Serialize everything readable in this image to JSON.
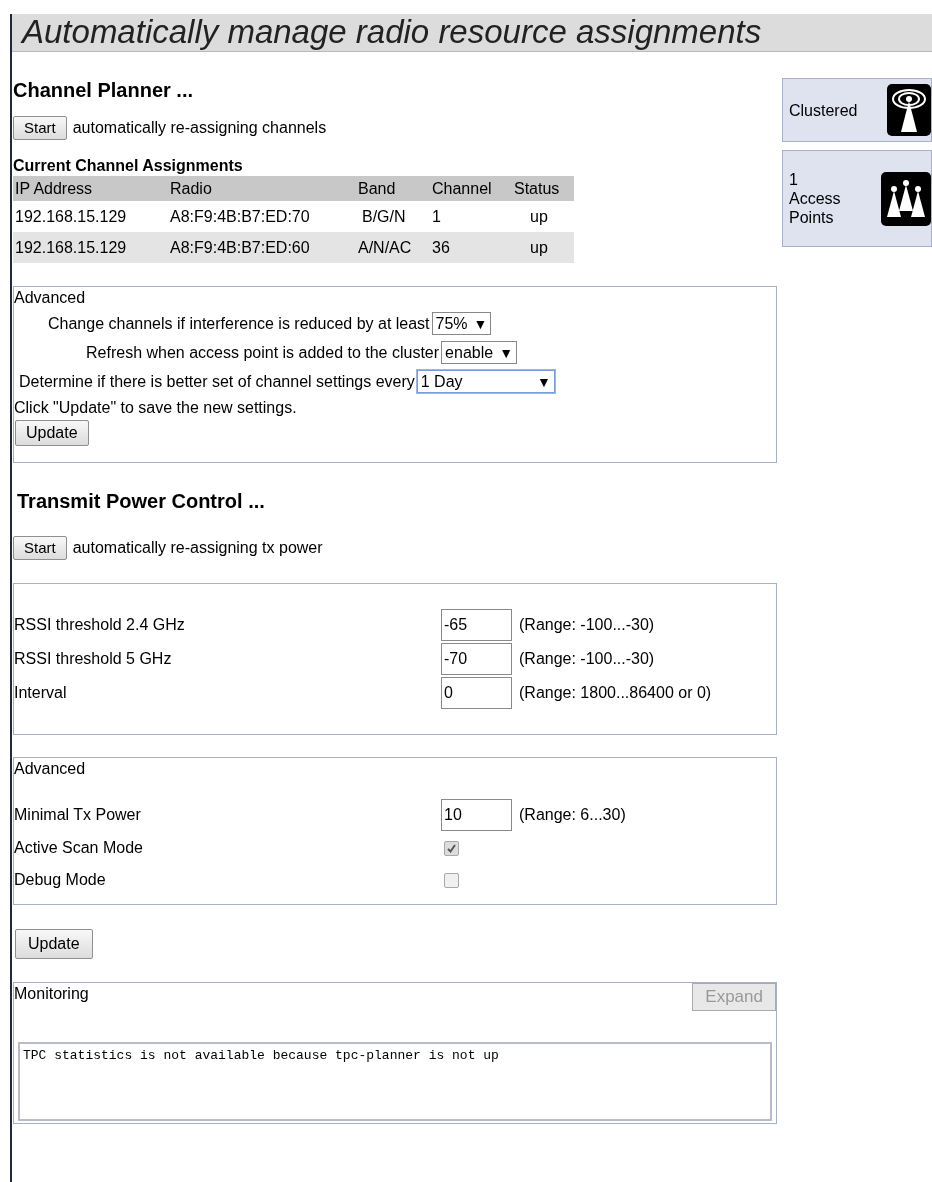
{
  "title": "Automatically manage radio resource assignments",
  "channel_planner": {
    "heading": "Channel Planner ...",
    "start_button": "Start",
    "start_note": "automatically re-assigning channels",
    "assignments_heading": "Current Channel Assignments",
    "table": {
      "columns": [
        "IP Address",
        "Radio",
        "Band",
        "Channel",
        "Status"
      ],
      "rows": [
        [
          "192.168.15.129",
          "A8:F9:4B:B7:ED:70",
          "B/G/N",
          "1",
          "up"
        ],
        [
          "192.168.15.129",
          "A8:F9:4B:B7:ED:60",
          "A/N/AC",
          "36",
          "up"
        ]
      ]
    },
    "advanced": {
      "legend": "Advanced",
      "settings": [
        {
          "label": "Change channels if interference is reduced by at least",
          "value": "75%",
          "arrow": "▼",
          "focused": false
        },
        {
          "label": "Refresh when access point is added to the cluster",
          "value": "enable",
          "arrow": "▼",
          "focused": false
        },
        {
          "label": "Determine if there is better set of channel settings every",
          "value": "1 Day",
          "arrow": "▼",
          "focused": true
        }
      ],
      "note": "Click \"Update\" to save the new settings.",
      "update_button": "Update"
    }
  },
  "status_panels": [
    {
      "kind": "clustered",
      "lines": [
        "Clustered"
      ]
    },
    {
      "kind": "access-points",
      "lines": [
        "1",
        "Access",
        "Points"
      ]
    }
  ],
  "tpc": {
    "heading": "Transmit Power Control ...",
    "start_button": "Start",
    "start_note": "automatically re-assigning tx power",
    "thresholds": [
      {
        "label": "RSSI threshold 2.4 GHz",
        "value": "-65",
        "range": "(Range: -100...-30)"
      },
      {
        "label": "RSSI threshold 5 GHz",
        "value": "-70",
        "range": "(Range: -100...-30)"
      },
      {
        "label": "Interval",
        "value": "0",
        "range": "(Range: 1800...86400 or 0)"
      }
    ],
    "advanced": {
      "legend": "Advanced",
      "items": [
        {
          "kind": "field",
          "label": "Minimal Tx Power",
          "value": "10",
          "range": "(Range: 6...30)"
        },
        {
          "kind": "checkbox",
          "label": "Active Scan Mode",
          "checked": true
        },
        {
          "kind": "checkbox",
          "label": "Debug Mode",
          "checked": false
        }
      ]
    },
    "update_button": "Update",
    "monitoring": {
      "legend": "Monitoring",
      "expand_button": "Expand",
      "expand_disabled": true,
      "output": "TPC statistics is not available because tpc-planner is not up"
    }
  }
}
